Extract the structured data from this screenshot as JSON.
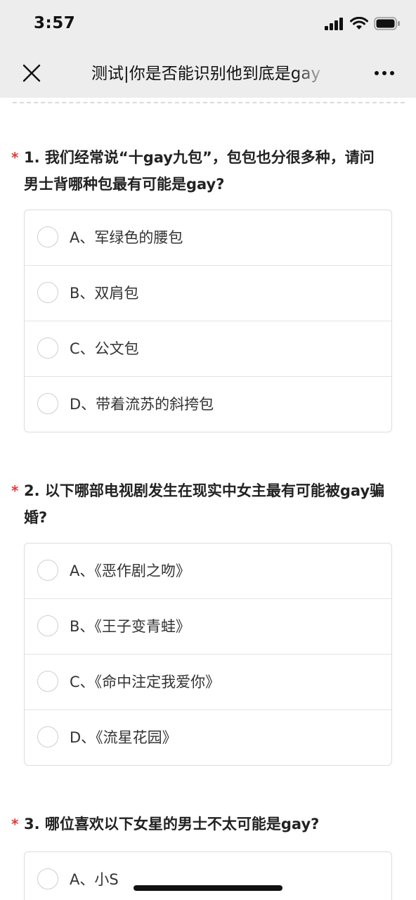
{
  "status_bar": {
    "time": "3:57"
  },
  "nav": {
    "title": "测试|你是否能识别他到底是gay"
  },
  "questions": [
    {
      "required_mark": "*",
      "title": "1. 我们经常说“十gay九包”，包包也分很多种，请问男士背哪种包最有可能是gay?",
      "options": [
        "A、军绿色的腰包",
        "B、双肩包",
        "C、公文包",
        "D、带着流苏的斜挎包"
      ]
    },
    {
      "required_mark": "*",
      "title": "2. 以下哪部电视剧发生在现实中女主最有可能被gay骗婚?",
      "options": [
        "A、《恶作剧之吻》",
        "B、《王子变青蛙》",
        "C、《命中注定我爱你》",
        "D、《流星花园》"
      ]
    },
    {
      "required_mark": "*",
      "title": "3. 哪位喜欢以下女星的男士不太可能是gay?",
      "options": [
        "A、小S"
      ]
    }
  ],
  "colors": {
    "required_star": "#e23a3a",
    "bar_background": "#ededed",
    "option_border": "#dcdcdc"
  }
}
